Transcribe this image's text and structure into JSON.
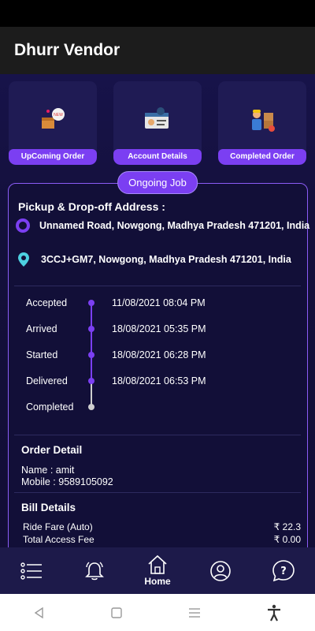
{
  "app": {
    "title": "Dhurr Vendor"
  },
  "cards": [
    {
      "label": "UpComing Order",
      "icon": "delivery-box-icon"
    },
    {
      "label": "Account Details",
      "icon": "account-card-icon"
    },
    {
      "label": "Completed Order",
      "icon": "delivery-person-icon"
    }
  ],
  "ongoing": {
    "badge": "Ongoing Job",
    "address_title": "Pickup & Drop-off Address :",
    "pickup": "Unnamed Road, Nowgong, Madhya Pradesh 471201, India",
    "dropoff": "3CCJ+GM7, Nowgong, Madhya Pradesh 471201, India"
  },
  "timeline": [
    {
      "label": "Accepted",
      "time": "11/08/2021 08:04 PM",
      "done": true
    },
    {
      "label": "Arrived",
      "time": "18/08/2021 05:35 PM",
      "done": true
    },
    {
      "label": "Started",
      "time": "18/08/2021 06:28 PM",
      "done": true
    },
    {
      "label": "Delivered",
      "time": "18/08/2021 06:53 PM",
      "done": true
    },
    {
      "label": "Completed",
      "time": "",
      "done": false
    }
  ],
  "order": {
    "title": "Order Detail",
    "name_line": "Name : amit",
    "mobile_line": "Mobile : 9589105092"
  },
  "bill": {
    "title": "Bill Details",
    "ride_fare_label": "Ride Fare  (Auto)",
    "ride_fare_value": "₹ 22.3",
    "access_fee_label": "Total Access Fee",
    "access_fee_value": "₹ 0.00"
  },
  "nav": {
    "home_label": "Home",
    "items": [
      "menu-icon",
      "bell-icon",
      "home-icon",
      "profile-icon",
      "help-icon"
    ]
  },
  "colors": {
    "accent": "#7b3ff2",
    "background": "#14103a",
    "drop_pin": "#4dd0e1"
  }
}
